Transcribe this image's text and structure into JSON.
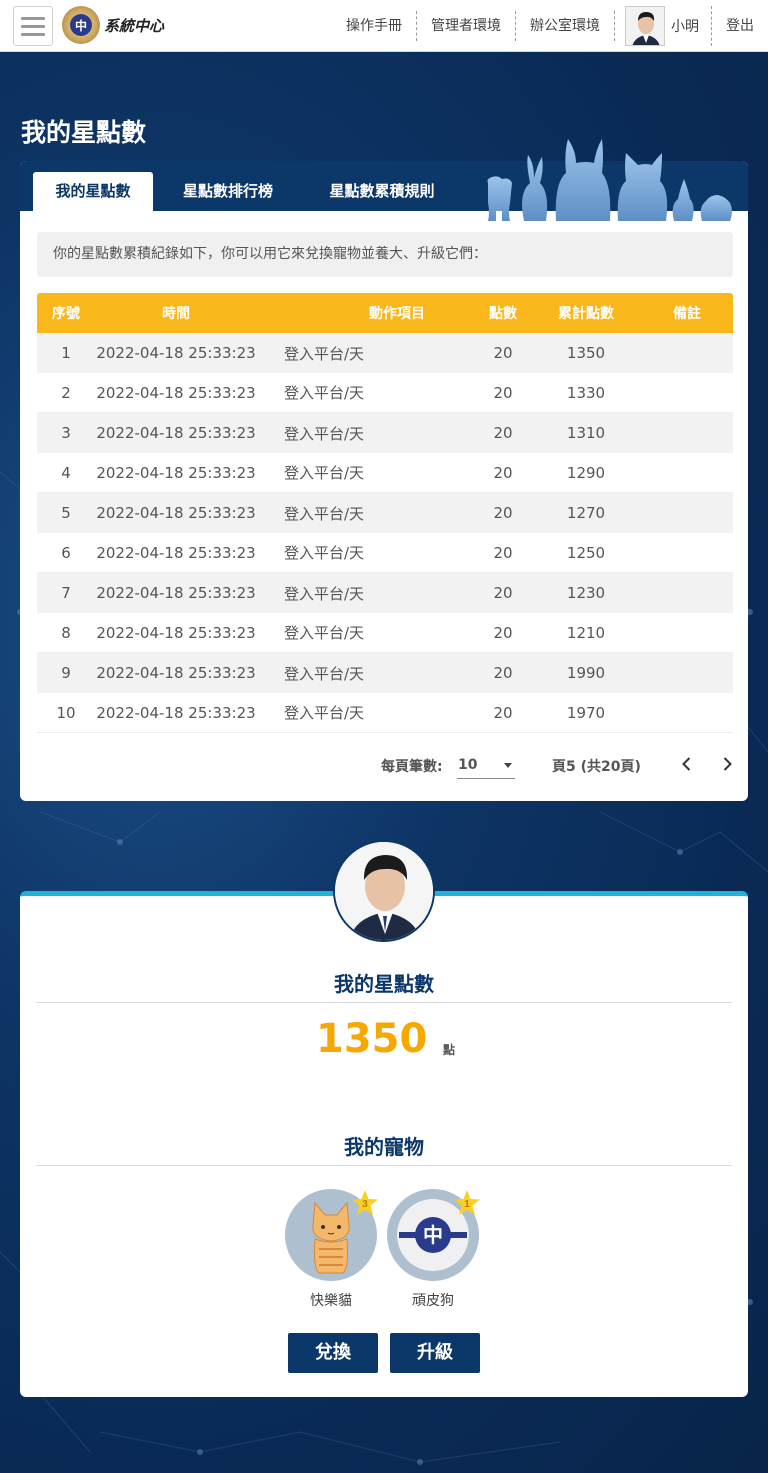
{
  "topbar": {
    "logo_text": "系統中心",
    "nav": [
      "操作手冊",
      "管理者環境",
      "辦公室環境"
    ],
    "user_name": "小明",
    "logout": "登出"
  },
  "page_title": "我的星點數",
  "tabs": [
    "我的星點數",
    "星點數排行榜",
    "星點數累積規則"
  ],
  "info_text": "你的星點數累積紀錄如下，你可以用它來兌換寵物並養大、升級它們：",
  "table": {
    "headers": [
      "序號",
      "時間",
      "動作項目",
      "點數",
      "累計點數",
      "備註"
    ],
    "rows": [
      [
        "1",
        "2022-04-18 25:33:23",
        "登入平台/天",
        "20",
        "1350",
        ""
      ],
      [
        "2",
        "2022-04-18 25:33:23",
        "登入平台/天",
        "20",
        "1330",
        ""
      ],
      [
        "3",
        "2022-04-18 25:33:23",
        "登入平台/天",
        "20",
        "1310",
        ""
      ],
      [
        "4",
        "2022-04-18 25:33:23",
        "登入平台/天",
        "20",
        "1290",
        ""
      ],
      [
        "5",
        "2022-04-18 25:33:23",
        "登入平台/天",
        "20",
        "1270",
        ""
      ],
      [
        "6",
        "2022-04-18 25:33:23",
        "登入平台/天",
        "20",
        "1250",
        ""
      ],
      [
        "7",
        "2022-04-18 25:33:23",
        "登入平台/天",
        "20",
        "1230",
        ""
      ],
      [
        "8",
        "2022-04-18 25:33:23",
        "登入平台/天",
        "20",
        "1210",
        ""
      ],
      [
        "9",
        "2022-04-18 25:33:23",
        "登入平台/天",
        "20",
        "1990",
        ""
      ],
      [
        "10",
        "2022-04-18 25:33:23",
        "登入平台/天",
        "20",
        "1970",
        ""
      ]
    ]
  },
  "pager": {
    "per_page_label": "每頁筆數:",
    "per_page_value": "10",
    "page_info": "頁5 (共20頁)",
    "prev_icon": "chevron-left-icon",
    "next_icon": "chevron-right-icon"
  },
  "profile": {
    "stars_title": "我的星點數",
    "points": "1350",
    "points_unit": "點",
    "pets_title": "我的寵物",
    "pets": [
      {
        "name": "快樂貓",
        "level": "3"
      },
      {
        "name": "頑皮狗",
        "level": "1"
      }
    ],
    "exchange_label": "兌換",
    "upgrade_label": "升級"
  },
  "colors": {
    "navy": "#0b3769",
    "accent_yellow": "#fab71c",
    "points_orange": "#f7a800",
    "cyan": "#20b2d8"
  }
}
